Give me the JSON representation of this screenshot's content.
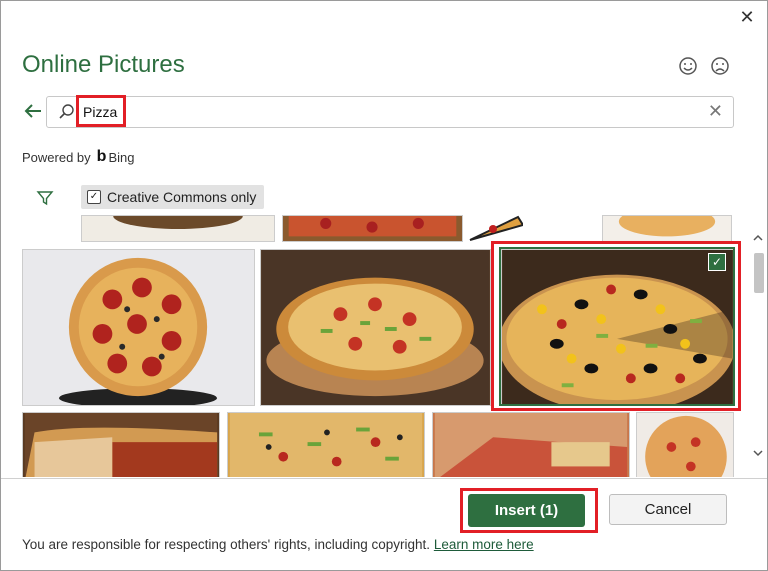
{
  "dialog": {
    "close_label": "✕",
    "title": "Online Pictures",
    "feedback": {
      "smile_icon": "smile-icon",
      "frown_icon": "frown-icon"
    }
  },
  "search": {
    "value": "Pizza",
    "clear_label": "✕"
  },
  "powered_by": {
    "label": "Powered by",
    "brand": "Bing"
  },
  "filter": {
    "creative_commons_label": "Creative Commons only",
    "creative_commons_checked": true
  },
  "gallery": {
    "selected_count": 1
  },
  "buttons": {
    "insert_label": "Insert (1)",
    "cancel_label": "Cancel"
  },
  "footer": {
    "notice": "You are responsible for respecting others' rights, including copyright.",
    "link": "Learn more here"
  },
  "colors": {
    "accent": "#2e6f40",
    "highlight": "#e21f26"
  }
}
